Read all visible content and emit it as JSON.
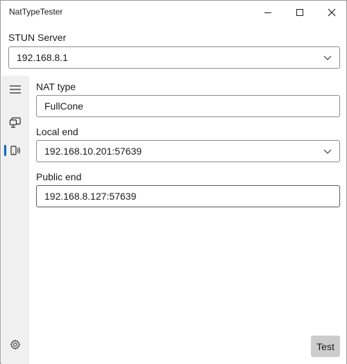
{
  "window": {
    "title": "NatTypeTester",
    "controls": [
      "minimize-icon",
      "maximize-icon",
      "close-icon"
    ]
  },
  "stun": {
    "label": "STUN Server",
    "selected": "192.168.8.1"
  },
  "nav": {
    "items": [
      {
        "icon": "hamburger-menu-icon"
      },
      {
        "icon": "server-icon"
      },
      {
        "icon": "client-icon",
        "active": true
      }
    ],
    "footer": {
      "icon": "gear-icon"
    }
  },
  "form": {
    "nat_type": {
      "label": "NAT type",
      "value": "FullCone"
    },
    "local_end": {
      "label": "Local end",
      "value": "192.168.10.201:57639"
    },
    "public_end": {
      "label": "Public end",
      "value": "192.168.8.127:57639"
    }
  },
  "actions": {
    "test_label": "Test"
  },
  "colors": {
    "accent": "#0067c0",
    "nav_background": "#f0f0f0",
    "button_background": "#cccccc"
  }
}
